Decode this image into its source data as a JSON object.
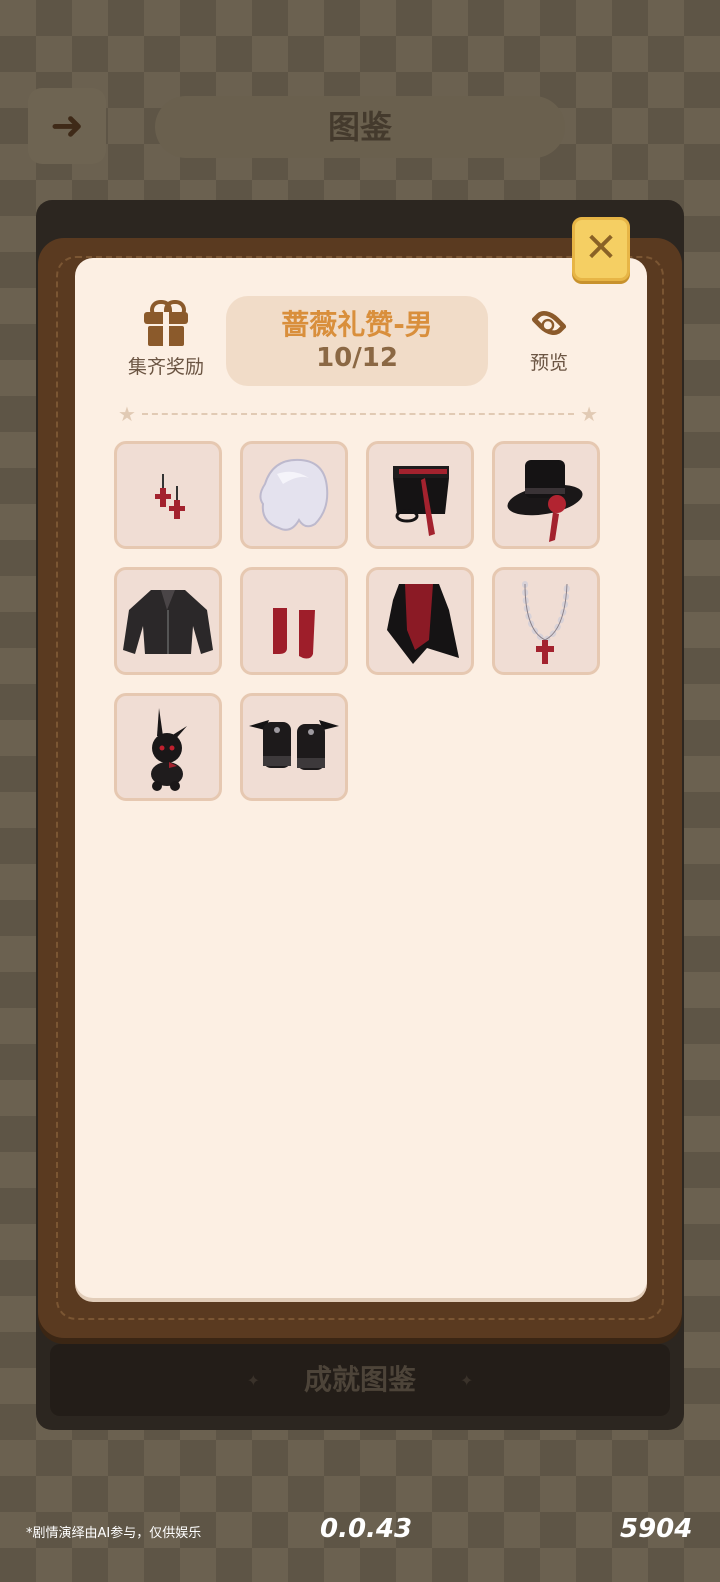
{
  "background": {
    "title": "图鉴",
    "bottom_button": "成就图鉴"
  },
  "panel": {
    "reward_label": "集齐奖励",
    "set_name": "蔷薇礼赞-男",
    "set_progress": "10/12",
    "preview_label": "预览",
    "close_icon": "close-icon"
  },
  "items": [
    {
      "name": "cross-earrings",
      "icon": "earring-icon"
    },
    {
      "name": "silver-wig",
      "icon": "hair-icon"
    },
    {
      "name": "black-belt-skirt",
      "icon": "belt-icon"
    },
    {
      "name": "rose-top-hat",
      "icon": "top-hat-icon"
    },
    {
      "name": "black-jacket",
      "icon": "jacket-icon"
    },
    {
      "name": "red-socks",
      "icon": "socks-icon"
    },
    {
      "name": "red-cape",
      "icon": "cape-icon"
    },
    {
      "name": "pearl-cross-necklace",
      "icon": "necklace-icon"
    },
    {
      "name": "black-bunny-doll",
      "icon": "bunny-icon"
    },
    {
      "name": "bat-wing-boots",
      "icon": "boots-icon"
    }
  ],
  "footer": {
    "note": "*剧情演绎由AI参与，仅供娱乐",
    "version": "0.0.43",
    "coins": "5904"
  }
}
